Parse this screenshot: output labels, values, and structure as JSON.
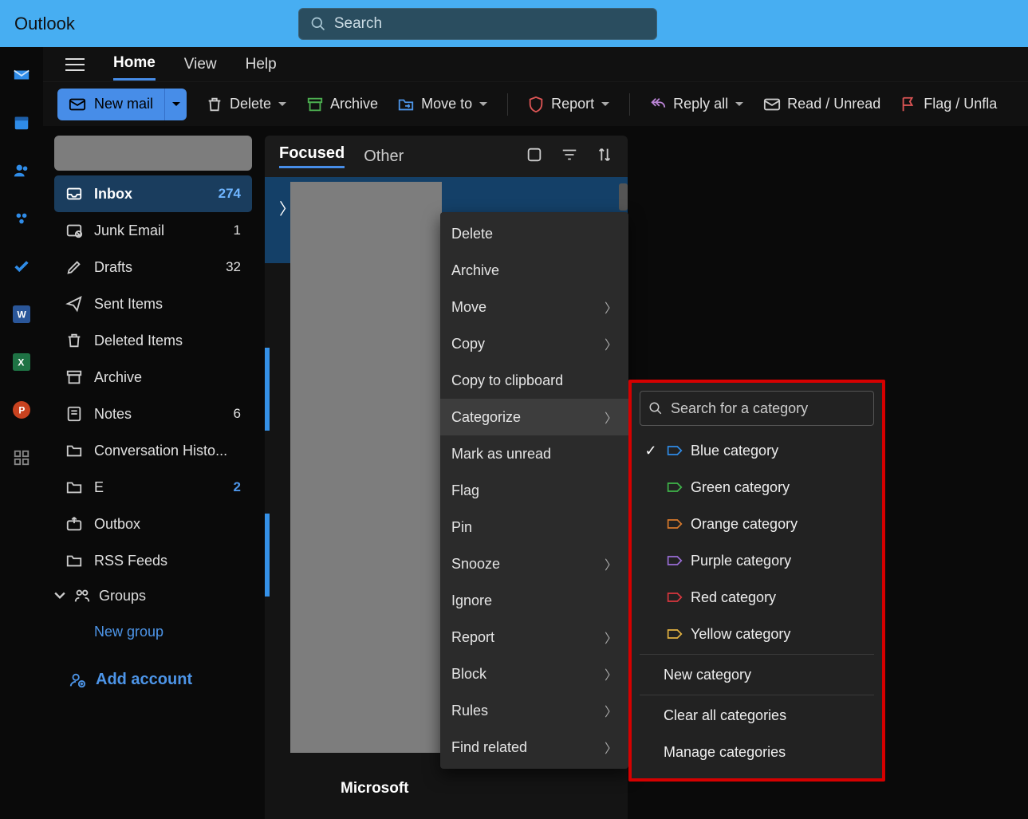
{
  "titlebar": {
    "app": "Outlook",
    "search_placeholder": "Search"
  },
  "maintabs": {
    "home": "Home",
    "view": "View",
    "help": "Help"
  },
  "toolbar": {
    "newmail": "New mail",
    "delete": "Delete",
    "archive": "Archive",
    "moveto": "Move to",
    "report": "Report",
    "replyall": "Reply all",
    "readunread": "Read / Unread",
    "flag": "Flag / Unfla"
  },
  "folders": {
    "inbox": {
      "label": "Inbox",
      "count": "274"
    },
    "junk": {
      "label": "Junk Email",
      "count": "1"
    },
    "drafts": {
      "label": "Drafts",
      "count": "32"
    },
    "sent": {
      "label": "Sent Items"
    },
    "deleted": {
      "label": "Deleted Items"
    },
    "archive": {
      "label": "Archive"
    },
    "notes": {
      "label": "Notes",
      "count": "6"
    },
    "conv": {
      "label": "Conversation Histo..."
    },
    "e": {
      "label": "E",
      "count": "2"
    },
    "outbox": {
      "label": "Outbox"
    },
    "rss": {
      "label": "RSS Feeds"
    },
    "groups": "Groups",
    "newgroup": "New group",
    "addaccount": "Add account"
  },
  "msghdr": {
    "focused": "Focused",
    "other": "Other"
  },
  "msglist": {
    "microsoft": "Microsoft"
  },
  "ctx": {
    "delete": "Delete",
    "archive": "Archive",
    "move": "Move",
    "copy": "Copy",
    "copy_clipboard": "Copy to clipboard",
    "categorize": "Categorize",
    "mark_unread": "Mark as unread",
    "flag": "Flag",
    "pin": "Pin",
    "snooze": "Snooze",
    "ignore": "Ignore",
    "report": "Report",
    "block": "Block",
    "rules": "Rules",
    "find_related": "Find related"
  },
  "cat": {
    "search": "Search for a category",
    "blue": "Blue category",
    "green": "Green category",
    "orange": "Orange category",
    "purple": "Purple category",
    "red": "Red category",
    "yellow": "Yellow category",
    "new": "New category",
    "clear": "Clear all categories",
    "manage": "Manage categories"
  }
}
